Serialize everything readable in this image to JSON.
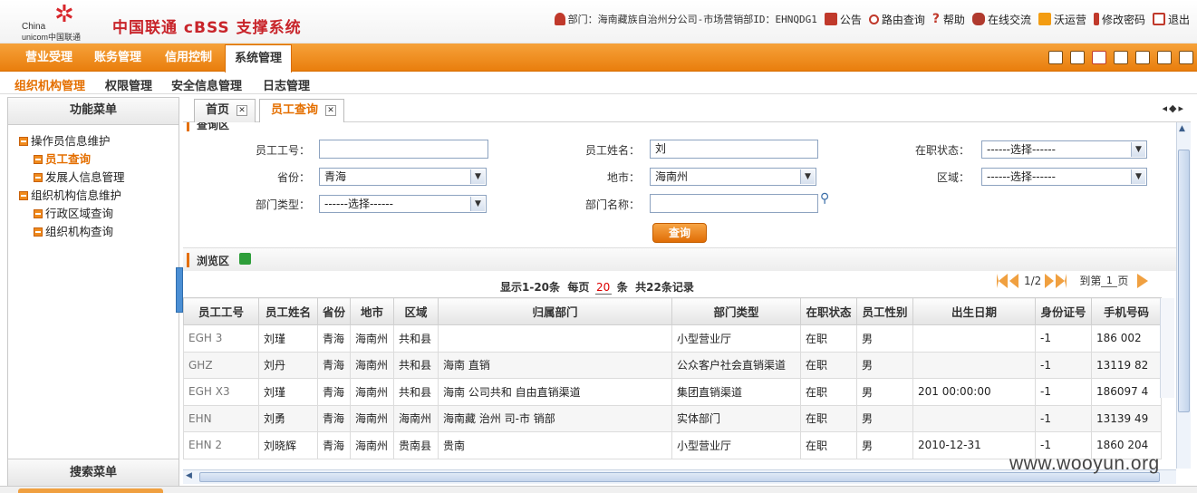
{
  "header": {
    "logo_china": "China",
    "logo_unicom": "unicom中国联通",
    "system_title": "中国联通 cBSS 支撑系统",
    "dept_info": "部门：海南藏族自治州分公司-市场营销部ID：EHNQDG1",
    "links": [
      "公告",
      "路由查询",
      "帮助",
      "在线交流",
      "沃运营",
      "修改密码",
      "退出"
    ]
  },
  "main_nav": [
    "营业受理",
    "账务管理",
    "信用控制",
    "系统管理"
  ],
  "sub_nav": [
    "组织机构管理",
    "权限管理",
    "安全信息管理",
    "日志管理"
  ],
  "left_panel": {
    "title": "功能菜单",
    "tree": [
      {
        "label": "操作员信息维护",
        "level": 0
      },
      {
        "label": "员工查询",
        "level": 1,
        "selected": true
      },
      {
        "label": "发展人信息管理",
        "level": 1
      },
      {
        "label": "组织机构信息维护",
        "level": 0
      },
      {
        "label": "行政区域查询",
        "level": 1
      },
      {
        "label": "组织机构查询",
        "level": 1
      }
    ],
    "footer": "搜索菜单"
  },
  "tabs": [
    {
      "label": "首页",
      "active": false
    },
    {
      "label": "员工查询",
      "active": true
    }
  ],
  "query": {
    "section_title": "查询区",
    "emp_id_label": "员工工号：",
    "emp_id_value": "",
    "emp_name_label": "员工姓名：",
    "emp_name_value": "刘",
    "status_label": "在职状态：",
    "status_value": "------选择------",
    "province_label": "省份：",
    "province_value": "青海",
    "city_label": "地市：",
    "city_value": "海南州",
    "area_label": "区域：",
    "area_value": "------选择------",
    "dept_type_label": "部门类型：",
    "dept_type_value": "------选择------",
    "dept_name_label": "部门名称：",
    "dept_name_value": "",
    "button": "查询"
  },
  "browse": {
    "section_title": "浏览区",
    "pager_show": "显示1-20条",
    "pager_per_page_prefix": "每页",
    "pager_per_page": "20",
    "pager_per_page_suffix": "条",
    "pager_total": "共22条记录",
    "page_current": "1/2",
    "goto_prefix": "到第",
    "goto_value": "1",
    "goto_suffix": "页"
  },
  "table": {
    "columns": [
      "员工工号",
      "员工姓名",
      "省份",
      "地市",
      "区域",
      "归属部门",
      "部门类型",
      "在职状态",
      "员工性别",
      "出生日期",
      "身份证号",
      "手机号码"
    ],
    "rows": [
      [
        "EGH  3",
        "刘瑾",
        "青海",
        "海南州",
        "共和县",
        "",
        "小型营业厅",
        "在职",
        "男",
        "",
        "-1",
        "186   002"
      ],
      [
        "GHZ",
        "刘丹",
        "青海",
        "海南州",
        "共和县",
        "海南       直销",
        "公众客户社会直销渠道",
        "在职",
        "男",
        "",
        "-1",
        "13119   82"
      ],
      [
        "EGH  X3",
        "刘瑾",
        "青海",
        "海南州",
        "共和县",
        "海南   公司共和   自由直销渠道",
        "集团直销渠道",
        "在职",
        "男",
        "201    00:00:00",
        "-1",
        "186097   4"
      ],
      [
        "EHN",
        "刘勇",
        "青海",
        "海南州",
        "海南州",
        "海南藏   治州   司-市   销部",
        "实体部门",
        "在职",
        "男",
        "",
        "-1",
        "13139   49"
      ],
      [
        "EHN  2",
        "刘晓辉",
        "青海",
        "海南州",
        "贵南县",
        "贵南    ",
        "小型营业厅",
        "在职",
        "男",
        "2010-12-31",
        "-1",
        "1860  204"
      ]
    ]
  },
  "watermark": "www.wooyun.org",
  "colors": {
    "brand_red": "#c8242a",
    "nav_orange": "#e97e0d",
    "accent_orange": "#e46f00"
  }
}
